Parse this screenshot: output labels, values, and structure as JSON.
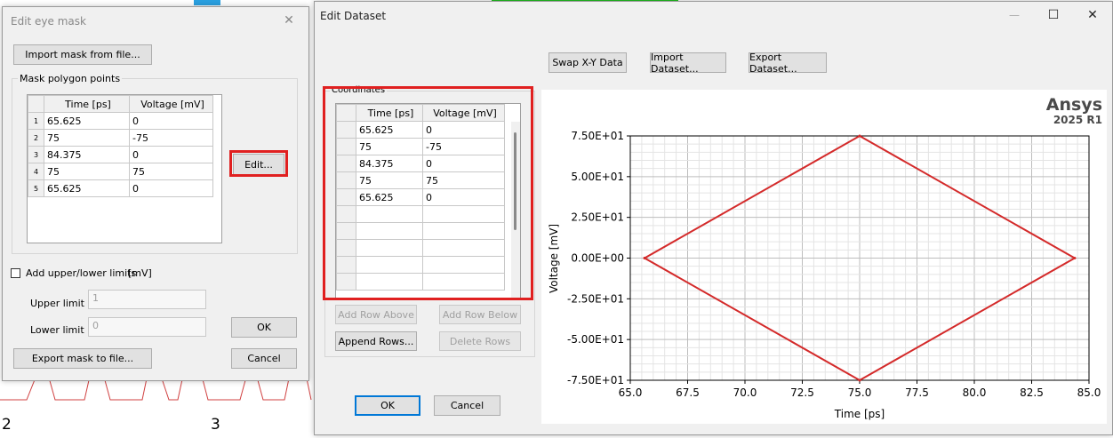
{
  "background": {
    "x_tick_left": "2",
    "x_tick_right": "3"
  },
  "eye_mask_dialog": {
    "title": "Edit eye mask",
    "close_glyph": "✕",
    "import_button": "Import mask from file...",
    "group_label": "Mask polygon points",
    "columns": [
      "Time [ps]",
      "Voltage [mV]"
    ],
    "rows": [
      {
        "n": "1",
        "time": "65.625",
        "voltage": "0"
      },
      {
        "n": "2",
        "time": "75",
        "voltage": "-75"
      },
      {
        "n": "3",
        "time": "84.375",
        "voltage": "0"
      },
      {
        "n": "4",
        "time": "75",
        "voltage": "75"
      },
      {
        "n": "5",
        "time": "65.625",
        "voltage": "0"
      }
    ],
    "edit_button": "Edit...",
    "limits_checkbox_label": "Add upper/lower limits",
    "limits_unit": "[mV]",
    "upper_limit_label": "Upper limit",
    "upper_limit_value": "1",
    "lower_limit_label": "Lower limit",
    "lower_limit_value": "0",
    "ok_button": "OK",
    "export_button": "Export mask to file...",
    "cancel_button": "Cancel"
  },
  "edit_dataset_dialog": {
    "title": "Edit Dataset",
    "minimize_glyph": "—",
    "maximize_glyph": "☐",
    "close_glyph": "✕",
    "swap_button": "Swap X-Y Data",
    "import_button": "Import Dataset...",
    "export_button": "Export Dataset...",
    "group_label": "Coordinates",
    "columns": [
      "Time [ps]",
      "Voltage [mV]"
    ],
    "rows": [
      {
        "time": "65.625",
        "voltage": "0"
      },
      {
        "time": "75",
        "voltage": "-75"
      },
      {
        "time": "84.375",
        "voltage": "0"
      },
      {
        "time": "75",
        "voltage": "75"
      },
      {
        "time": "65.625",
        "voltage": "0"
      },
      {
        "time": "",
        "voltage": ""
      },
      {
        "time": "",
        "voltage": ""
      },
      {
        "time": "",
        "voltage": ""
      },
      {
        "time": "",
        "voltage": ""
      },
      {
        "time": "",
        "voltage": ""
      }
    ],
    "add_above_button": "Add Row Above",
    "add_below_button": "Add Row Below",
    "append_button": "Append Rows...",
    "delete_button": "Delete Rows",
    "ok_button": "OK",
    "cancel_button": "Cancel",
    "brand": "Ansys",
    "version": "2025 R1"
  },
  "colors": {
    "highlight": "#e02020",
    "curve": "#d42a2a"
  },
  "chart_data": {
    "type": "line",
    "title": "",
    "xlabel": "Time [ps]",
    "ylabel": "Voltage [mV]",
    "xlim": [
      65.0,
      85.0
    ],
    "ylim": [
      -75,
      75
    ],
    "x_ticks": [
      "65.0",
      "67.5",
      "70.0",
      "72.5",
      "75.0",
      "77.5",
      "80.0",
      "82.5",
      "85.0"
    ],
    "y_ticks": [
      "7.50E+01",
      "5.00E+01",
      "2.50E+01",
      "0.00E+00",
      "-2.50E+01",
      "-5.00E+01",
      "-7.50E+01"
    ],
    "grid": true,
    "series": [
      {
        "x": [
          65.625,
          75,
          84.375,
          75,
          65.625
        ],
        "y": [
          0,
          -75,
          0,
          75,
          0
        ]
      }
    ]
  }
}
